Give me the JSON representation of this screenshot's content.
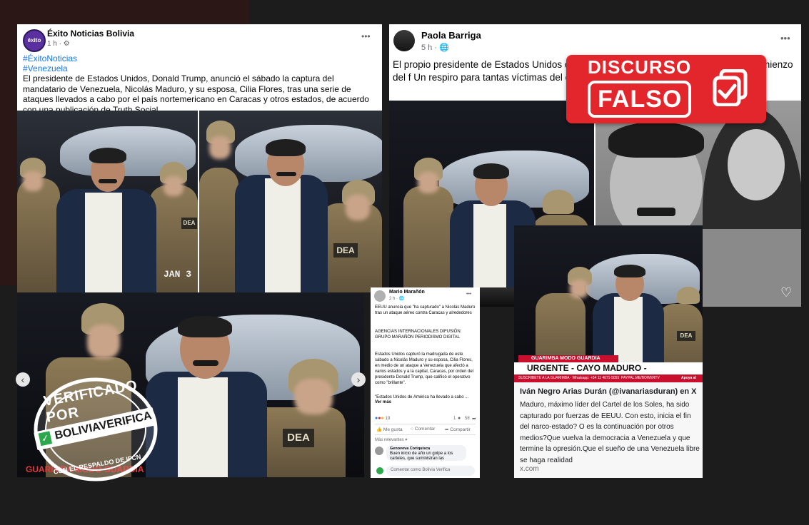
{
  "post1": {
    "author": "Éxito Noticias Bolivia",
    "time": "1 h · ⚙",
    "avatar_text": "éxito",
    "hashtag1": "#ÉxitoNoticias",
    "hashtag2": "#Venezuela",
    "body": "El presidente de Estados Unidos, Donald Trump, anunció el sábado la captura del mandatario de Venezuela, Nicolás Maduro, y su esposa, Cilia Flores, tras una serie de ataques llevados a cabo por el país nortemericano en Caracas y otros estados, de acuerdo con una publicación de Truth Social.",
    "more": "•••",
    "photo_stamp": "JAN 3"
  },
  "post2": {
    "author": "Paola Barriga",
    "time": "5 h · 🌐",
    "body": "El propio presidente de Estados Unidos conf                                           aro y su esposa. Estaríamos viendo el comienzo del f                                   Un respiro para tantas víctimas del éxodo ve",
    "more": "•••"
  },
  "badge": {
    "line1": "DISCURSO",
    "line2": "FALSO"
  },
  "post3": {
    "author": "Mario Marañón",
    "time": "2 h · 🌐",
    "more": "•••",
    "p1": "EEUU anuncia que \"ha capturado\" a Nicolás Maduro tras un ataque aéreo contra Caracas y alrededores",
    "p2": "AGENCIAS INTERNACIONALES DIFUSIÓN: GRUPO MARAÑÓN PERIODISMO DIGITAL",
    "p3": "Estados Unidos capturó la madrugada de este sábado a Nicolás Maduro y su esposa, Cilia Flores, en medio de un ataque a Venezuela que afectó a varios estados y a la capital, Caracas, por orden del presidente Donald Trump, que calificó el operativo como \"brillante\".",
    "p4": "\"Estados Unidos de América ha llevado a cabo ...",
    "see_more": "Ver más",
    "reactions_count": "19",
    "comments_count": "1",
    "shares_count": "58",
    "like": "Me gusta",
    "comment": "Comentar",
    "share": "Compartir",
    "relevant": "Más relevantes",
    "commenter": "Genoveva Coriquisca",
    "comment_text": "Buen inicio de año un golpe a los carteles, que suministran las",
    "comment_placeholder": "Comentar como Bolivia Verifica"
  },
  "post4": {
    "banner_small": "GUARIMBA MODO GUARDIA",
    "banner": "URGENTE - CAYO MADURO - CAPTURADO!",
    "ticker_left": "SUSCRIBETE A LA GUARIMBA - Whatsapp: +54 11 4671-5055",
    "ticker_mid": "PAYPAL.ME/BOWERTV",
    "ticker_right": "Apoya al",
    "title": "Iván Negro Arias Durán (@ivanariasduran) en X",
    "body": "Maduro, máximo líder del Cartel de los Soles, ha sido capturado por fuerzas de EEUU. Con esto, inicia el fin del narco-estado? O es la continuación por otros medios?Que vuelva la democracia a Venezuela y que termine la opresión.Que el sueño de una Venezuela libre se haga realidad",
    "domain": "x.com"
  },
  "photo_big": {
    "watermark": "GUARIMBA MODO GUARDIA"
  },
  "stamp": {
    "top": "VERIFICADO POR",
    "brand": "BOLIVIAVERIFICA",
    "bottom": "CON EL RESPALDO DE IFCN"
  },
  "colors": {
    "hashtag": "#1877f2",
    "badge_red": "#e3262c",
    "banner_red": "#c8102e"
  }
}
